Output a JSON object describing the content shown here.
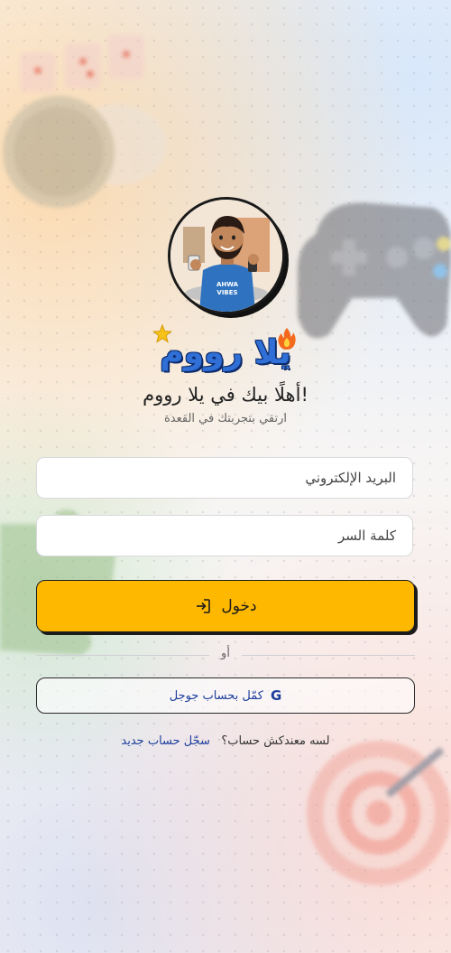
{
  "app": {
    "logo_text": "يلا رووم",
    "welcome": "أهلًا بيك في يلا رووم!",
    "subtitle": "ارتقي بتجربتك في القعدة"
  },
  "avatar": {
    "shirt_text_line1": "AHWA",
    "shirt_text_line2": "VIBES"
  },
  "form": {
    "email_placeholder": "البريد الإلكتروني",
    "email_value": "",
    "password_placeholder": "كلمة السر",
    "password_value": "",
    "login_label": "دخول",
    "or_label": "أو",
    "google_label": "كمّل بحساب جوجل",
    "google_letter": "G"
  },
  "signup": {
    "prompt": "لسه معندكش حساب؟",
    "link": "سجّل حساب جديد"
  },
  "colors": {
    "primary_button": "#ffb800",
    "link": "#1c3e9c",
    "logo": "#2f6fd6"
  },
  "icons": {
    "star": "star-icon",
    "fire": "fire-icon",
    "login": "login-icon",
    "google": "google-icon"
  }
}
